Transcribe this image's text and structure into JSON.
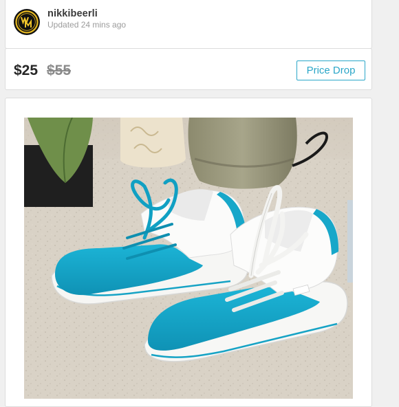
{
  "seller": {
    "username": "nikkibeerli",
    "updated": "Updated 24 mins ago",
    "avatar_icon": "wm-monogram-logo"
  },
  "pricing": {
    "current_price": "$25",
    "original_price": "$55",
    "badge_label": "Price Drop",
    "accent_color": "#2aa6c8"
  },
  "listing_photo": {
    "subject": "turquoise-and-white-canvas-sneakers",
    "shoe_color": "#17a7c9"
  }
}
